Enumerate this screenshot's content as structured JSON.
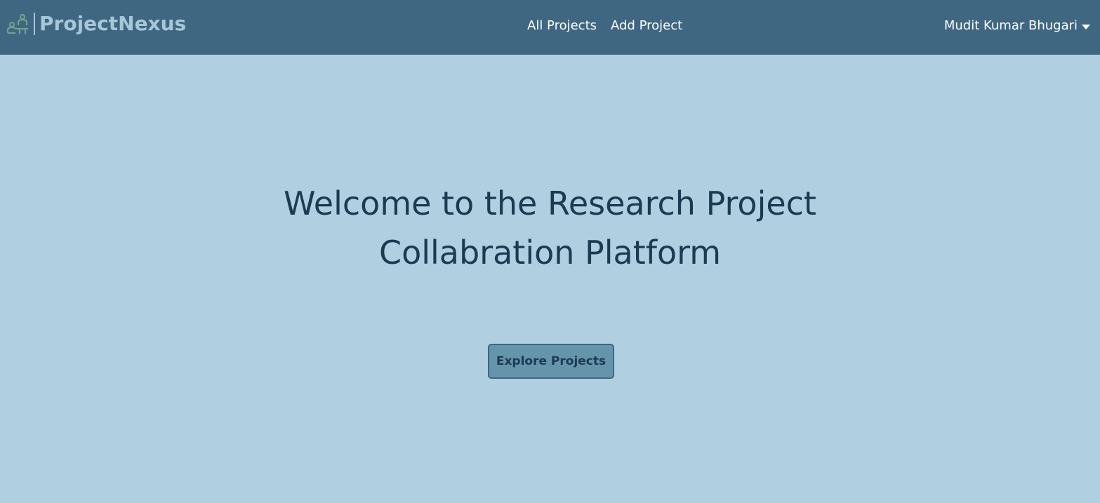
{
  "navbar": {
    "brand_name": "ProjectNexus",
    "logo_icon": "people-collaboration-icon",
    "links": [
      {
        "label": "All Projects"
      },
      {
        "label": "Add Project"
      }
    ],
    "user_name": "Mudit Kumar Bhugari"
  },
  "hero": {
    "title_line_1": "Welcome to the Research Project",
    "title_line_2": "Collabration Platform",
    "cta_label": "Explore Projects"
  },
  "colors": {
    "navbar_bg": "#3f6782",
    "page_bg": "#b0cfe1",
    "brand_text": "#a7c6d8",
    "title_text": "#1c3a52",
    "button_bg": "#6595ab"
  }
}
